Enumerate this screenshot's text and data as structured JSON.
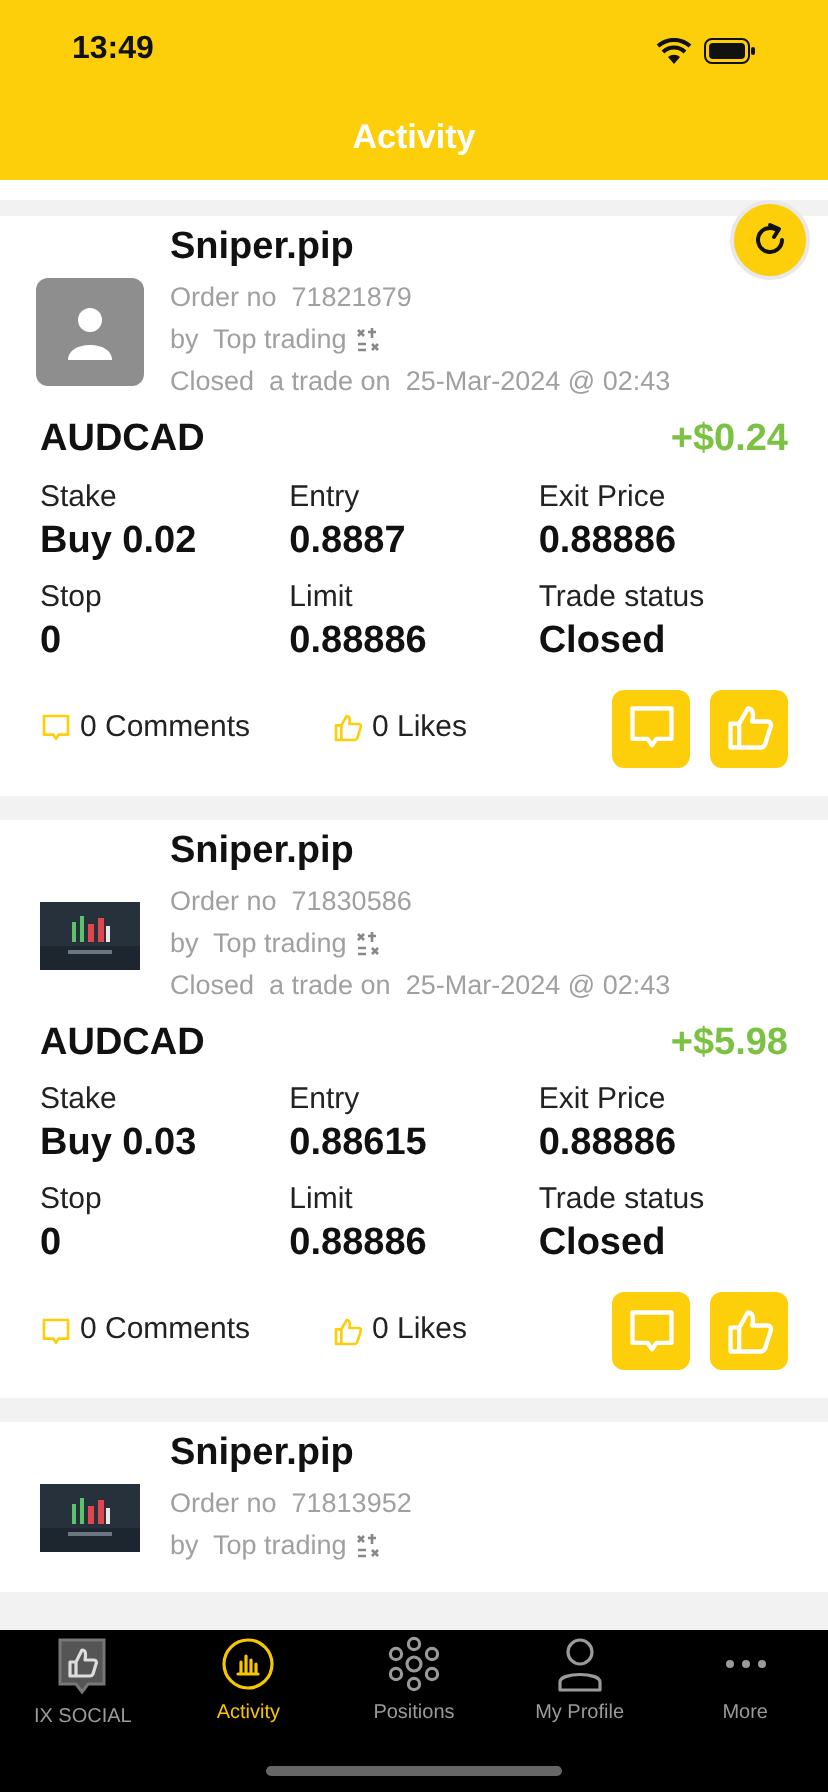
{
  "status_bar": {
    "time": "13:49"
  },
  "header": {
    "title": "Activity"
  },
  "cards": [
    {
      "avatar": {
        "kind": "placeholder"
      },
      "name": "Sniper.pip",
      "order": "Order no  71821879",
      "by": "by  Top trading",
      "closed": "Closed  a trade on  25-Mar-2024 @ 02:43",
      "symbol": "AUDCAD",
      "profit": "+$0.24",
      "fields": [
        {
          "label": "Stake",
          "value": "Buy 0.02"
        },
        {
          "label": "Entry",
          "value": "0.8887"
        },
        {
          "label": "Exit Price",
          "value": "0.88886"
        },
        {
          "label": "Stop",
          "value": "0"
        },
        {
          "label": "Limit",
          "value": "0.88886"
        },
        {
          "label": "Trade status",
          "value": "Closed"
        }
      ],
      "comments": "0 Comments",
      "likes": "0 Likes"
    },
    {
      "name": "Sniper.pip",
      "order": "Order no  71830586",
      "by": "by  Top trading",
      "closed": "Closed  a trade on  25-Mar-2024 @ 02:43",
      "symbol": "AUDCAD",
      "profit": "+$5.98",
      "fields": [
        {
          "label": "Stake",
          "value": "Buy 0.03"
        },
        {
          "label": "Entry",
          "value": "0.88615"
        },
        {
          "label": "Exit Price",
          "value": "0.88886"
        },
        {
          "label": "Stop",
          "value": "0"
        },
        {
          "label": "Limit",
          "value": "0.88886"
        },
        {
          "label": "Trade status",
          "value": "Closed"
        }
      ],
      "comments": "0 Comments",
      "likes": "0 Likes"
    },
    {
      "name": "Sniper.pip",
      "order": "Order no  71813952",
      "by": "by  Top trading"
    }
  ],
  "tabs": [
    {
      "kind": "social",
      "label": "IX SOCIAL",
      "selected": false
    },
    {
      "kind": "activity",
      "label": "Activity",
      "selected": true
    },
    {
      "kind": "positions",
      "label": "Positions",
      "selected": false
    },
    {
      "kind": "profile",
      "label": "My Profile",
      "selected": false
    },
    {
      "kind": "more",
      "label": "More",
      "selected": false
    }
  ]
}
